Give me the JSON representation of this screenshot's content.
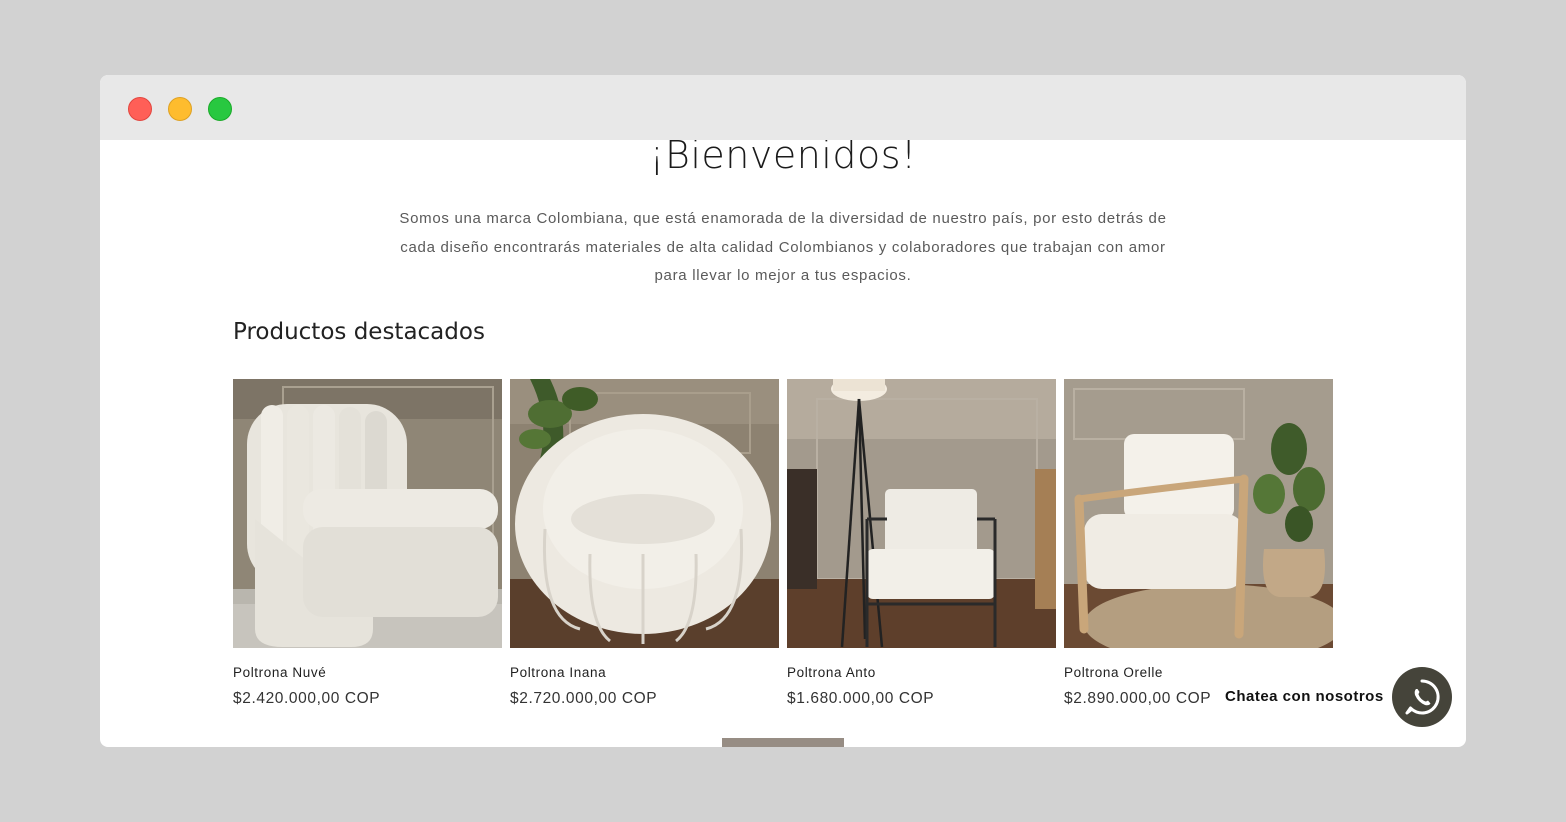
{
  "page": {
    "welcome_title": "¡Bienvenidos!",
    "intro_text": "Somos una marca Colombiana, que está enamorada de la diversidad de nuestro país, por esto detrás de cada diseño encontrarás  materiales de alta calidad Colombianos y colaboradores que trabajan con amor para llevar lo mejor a tus espacios."
  },
  "featured": {
    "title": "Productos destacados",
    "products": [
      {
        "name": "Poltrona Nuvé",
        "price": "$2.420.000,00 COP",
        "image": "channel-tufted-boucle-armless-chair"
      },
      {
        "name": "Poltrona Inana",
        "price": "$2.720.000,00 COP",
        "image": "round-boucle-pumpkin-armchair"
      },
      {
        "name": "Poltrona Anto",
        "price": "$1.680.000,00 COP",
        "image": "white-cushion-metal-frame-chair"
      },
      {
        "name": "Poltrona Orelle",
        "price": "$2.890.000,00 COP",
        "image": "wooden-frame-cream-armchair"
      }
    ]
  },
  "chat": {
    "label": "Chatea con nosotros",
    "icon": "whatsapp-icon"
  },
  "colors": {
    "accent": "#978d84",
    "chat_button": "#45443a"
  }
}
